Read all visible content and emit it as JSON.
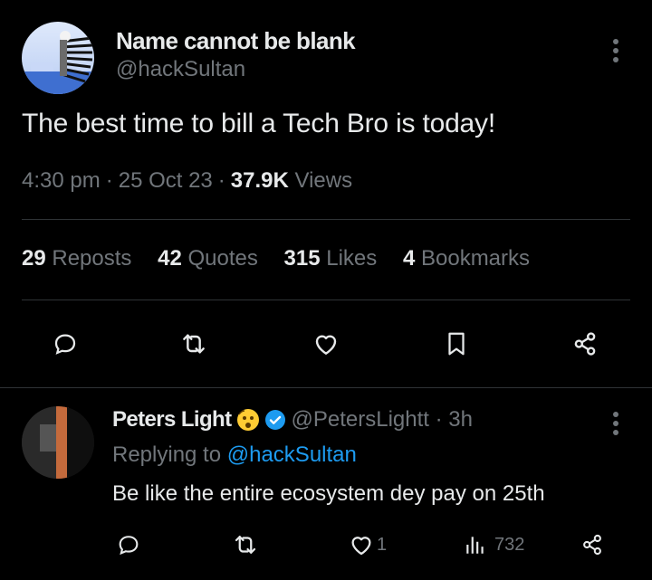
{
  "tweet": {
    "author_name": "Name cannot be blank",
    "author_handle": "@hackSultan",
    "text": "The best time to bill a Tech Bro is today!",
    "time": "4:30 pm",
    "date": "25 Oct 23",
    "views_count": "37.9K",
    "views_label": "Views",
    "stats": [
      {
        "count": "29",
        "label": "Reposts"
      },
      {
        "count": "42",
        "label": "Quotes"
      },
      {
        "count": "315",
        "label": "Likes"
      },
      {
        "count": "4",
        "label": "Bookmarks"
      }
    ],
    "actions": [
      "reply-icon",
      "repost-icon",
      "like-icon",
      "bookmark-icon",
      "share-icon"
    ]
  },
  "reply": {
    "author_name": "Peters Light",
    "author_handle": "@PetersLightt",
    "time": "3h",
    "replying_prefix": "Replying to",
    "replying_to": "@hackSultan",
    "text": "Be like the entire ecosystem dey pay on 25th",
    "like_count": "1",
    "view_count": "732",
    "actions": [
      "reply-icon",
      "repost-icon",
      "like-icon",
      "views-icon",
      "share-icon"
    ]
  },
  "colors": {
    "background": "#000000",
    "text": "#e7e9ea",
    "muted": "#71767b",
    "link": "#1d9bf0",
    "divider": "#2f3336",
    "verified": "#1d9bf0"
  }
}
